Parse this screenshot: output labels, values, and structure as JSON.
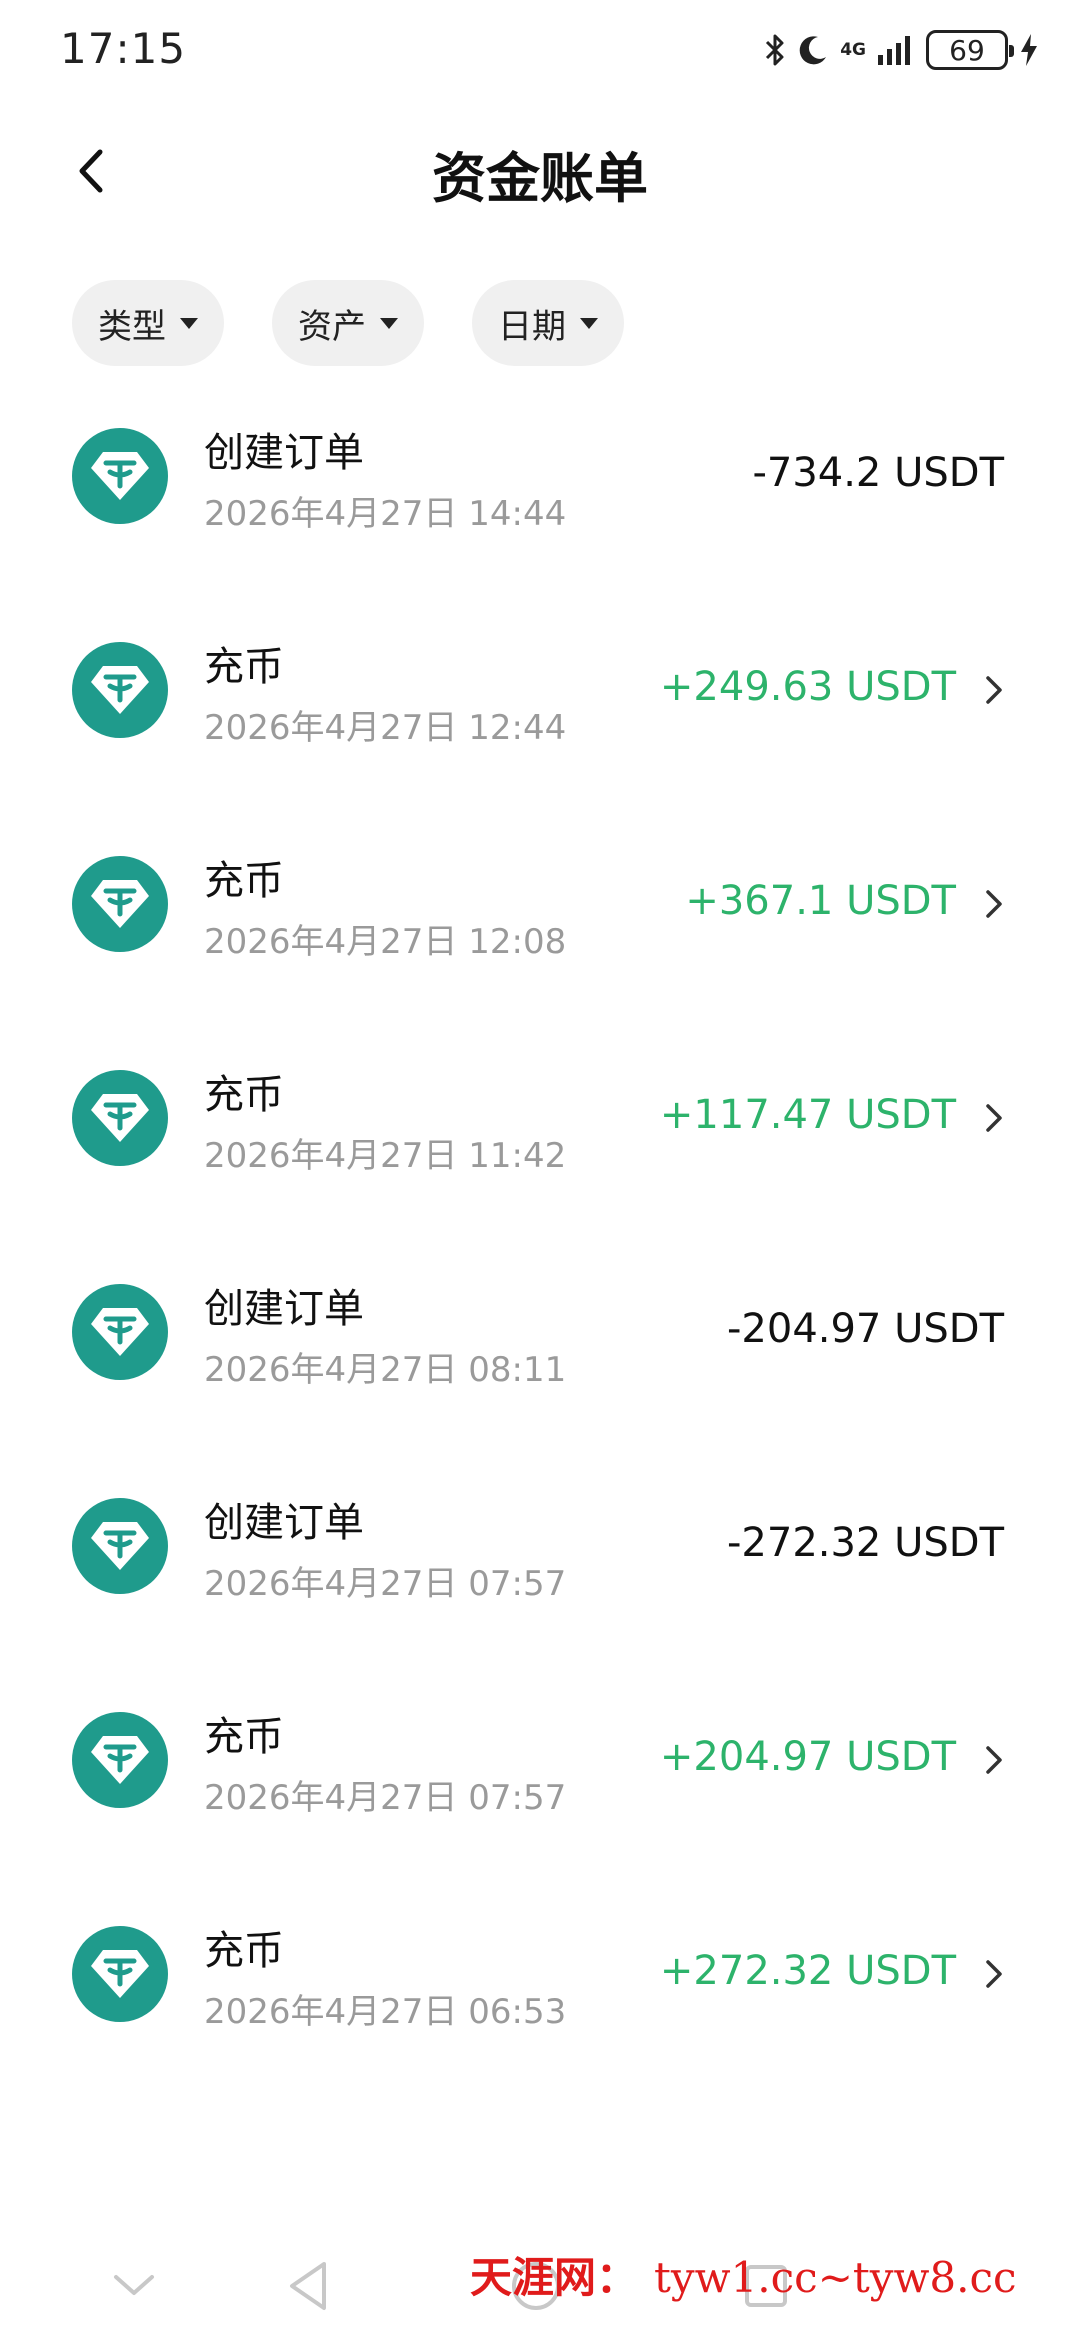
{
  "status_bar": {
    "time": "17:15",
    "network": "4G",
    "battery": "69",
    "icons": [
      "bluetooth-icon",
      "moon-icon",
      "signal-icon",
      "battery-icon",
      "charging-icon"
    ]
  },
  "header": {
    "title": "资金账单",
    "back_icon": "chevron-left-icon"
  },
  "filters": [
    {
      "label": "类型"
    },
    {
      "label": "资产"
    },
    {
      "label": "日期"
    }
  ],
  "colors": {
    "coin": "#1f9b8c",
    "positive": "#2db36b",
    "date_text": "#9a9a9a",
    "chip_bg": "#f0f0f0"
  },
  "transactions": [
    {
      "title": "创建订单",
      "date": "2026年4月27日 14:44",
      "amount": "-734.2 USDT",
      "positive": false
    },
    {
      "title": "充币",
      "date": "2026年4月27日 12:44",
      "amount": "+249.63 USDT",
      "positive": true
    },
    {
      "title": "充币",
      "date": "2026年4月27日 12:08",
      "amount": "+367.1 USDT",
      "positive": true
    },
    {
      "title": "充币",
      "date": "2026年4月27日 11:42",
      "amount": "+117.47 USDT",
      "positive": true
    },
    {
      "title": "创建订单",
      "date": "2026年4月27日 08:11",
      "amount": "-204.97 USDT",
      "positive": false
    },
    {
      "title": "创建订单",
      "date": "2026年4月27日 07:57",
      "amount": "-272.32 USDT",
      "positive": false
    },
    {
      "title": "充币",
      "date": "2026年4月27日 07:57",
      "amount": "+204.97 USDT",
      "positive": true
    },
    {
      "title": "充币",
      "date": "2026年4月27日 06:53",
      "amount": "+272.32 USDT",
      "positive": true
    }
  ],
  "watermark": {
    "site": "天涯网：",
    "urls": "tyw1.cc~tyw8.cc"
  }
}
